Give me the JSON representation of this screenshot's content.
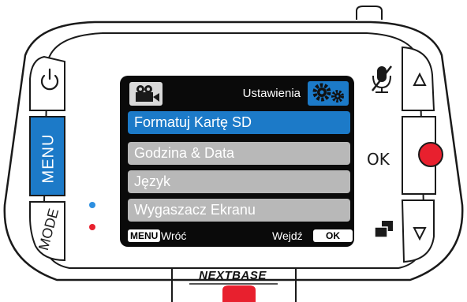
{
  "device": {
    "brand": "NEXTBASE",
    "left_buttons": {
      "menu_label": "MENU",
      "mode_label": "MODE"
    },
    "right_buttons": {
      "ok_label": "OK"
    },
    "colors": {
      "accent_blue": "#1c7ac8",
      "record_red": "#e8202e",
      "led_blue": "#2d8fe0",
      "led_red": "#e8202e"
    }
  },
  "screen": {
    "title": "Ustawienia",
    "menu_items": [
      {
        "label": "Formatuj Kartę SD",
        "selected": true
      },
      {
        "label": "Godzina & Data",
        "selected": false
      },
      {
        "label": "Język",
        "selected": false
      },
      {
        "label": "Wygaszacz Ekranu",
        "selected": false
      }
    ],
    "footer": {
      "menu_key": "MENU",
      "back_label": "Wróć",
      "enter_label": "Wejdź",
      "ok_key": "OK"
    }
  }
}
